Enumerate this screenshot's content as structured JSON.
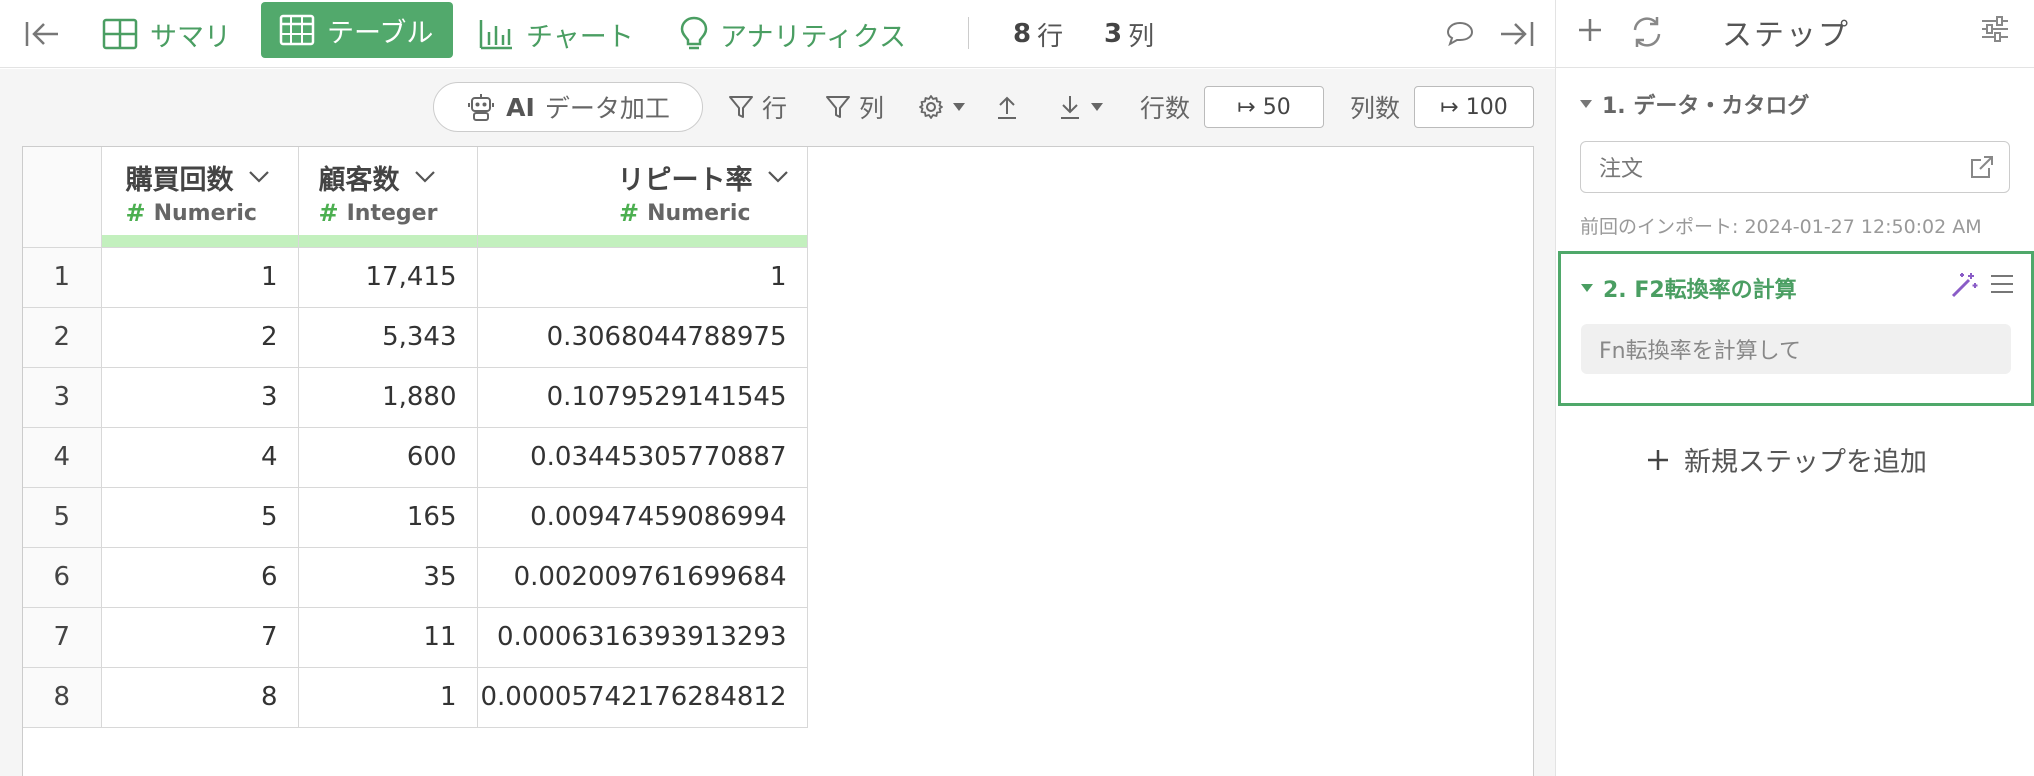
{
  "topbar": {
    "tabs": [
      {
        "label": "サマリ"
      },
      {
        "label": "テーブル"
      },
      {
        "label": "チャート"
      },
      {
        "label": "アナリティクス"
      }
    ],
    "rows_value": "8",
    "rows_unit": "行",
    "cols_value": "3",
    "cols_unit": "列",
    "accent_color": "#52a96c"
  },
  "toolbar": {
    "ai_label_bold": "AI",
    "ai_label": "データ加工",
    "filter_row": "行",
    "filter_col": "列",
    "rows_label": "行数",
    "rows_value": "↦ 50",
    "cols_label": "列数",
    "cols_value": "↦ 100"
  },
  "table": {
    "columns": [
      {
        "name": "購買回数",
        "type": "Numeric"
      },
      {
        "name": "顧客数",
        "type": "Integer"
      },
      {
        "name": "リピート率",
        "type": "Numeric"
      }
    ],
    "rows": [
      {
        "idx": "1",
        "c1": "1",
        "c2": "17,415",
        "c3": "1"
      },
      {
        "idx": "2",
        "c1": "2",
        "c2": "5,343",
        "c3": "0.3068044788975"
      },
      {
        "idx": "3",
        "c1": "3",
        "c2": "1,880",
        "c3": "0.1079529141545"
      },
      {
        "idx": "4",
        "c1": "4",
        "c2": "600",
        "c3": "0.03445305770887"
      },
      {
        "idx": "5",
        "c1": "5",
        "c2": "165",
        "c3": "0.00947459086994"
      },
      {
        "idx": "6",
        "c1": "6",
        "c2": "35",
        "c3": "0.002009761699684"
      },
      {
        "idx": "7",
        "c1": "7",
        "c2": "11",
        "c3": "0.0006316393913293"
      },
      {
        "idx": "8",
        "c1": "8",
        "c2": "1",
        "c3": "0.00005742176284812"
      }
    ]
  },
  "steps_panel": {
    "title": "ステップ",
    "step1": {
      "title": "1. データ・カタログ",
      "source": "注文",
      "import_note": "前回のインポート: 2024-01-27 12:50:02 AM"
    },
    "step2": {
      "title": "2. F2転換率の計算",
      "placeholder": "Fn転換率を計算して"
    },
    "add_step": "新規ステップを追加"
  }
}
